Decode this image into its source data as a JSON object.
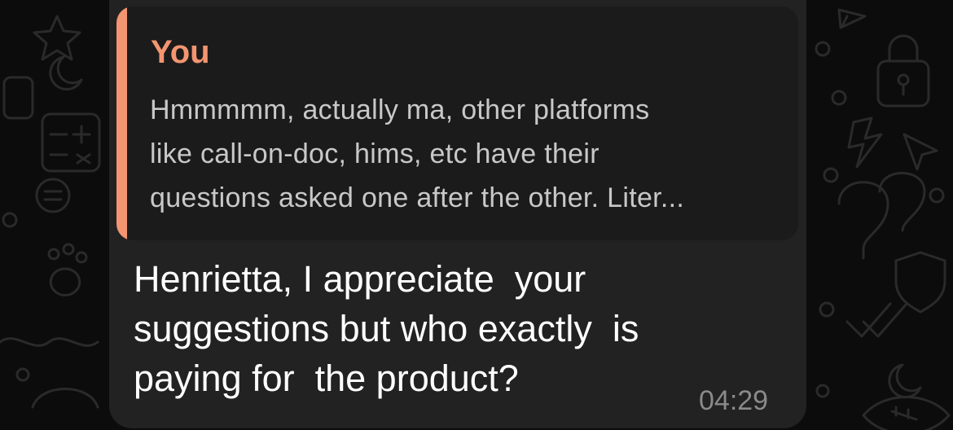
{
  "chat": {
    "message": {
      "quote": {
        "author": "You",
        "lines": [
          "Hmmmmm, actually ma, other platforms",
          "like call-on-doc, hims, etc have their",
          "questions asked one after the other. Liter..."
        ]
      },
      "text_lines": [
        "Henrietta, I appreciate  your",
        "suggestions but who exactly  is",
        "paying for  the product?"
      ],
      "time": "04:29"
    }
  },
  "colors": {
    "background": "#0c0c0c",
    "bubble": "#222222",
    "quote_background": "#1b1b1b",
    "quote_accent": "#f39571",
    "quote_text": "#c8c8c8",
    "message_text": "#ffffff",
    "timestamp": "#8a8a8a"
  },
  "icons": [
    "send-doodle-icon",
    "lock-doodle-icon",
    "lightning-doodle-icon",
    "calculator-doodle-icon",
    "moon-doodle-icon",
    "paw-doodle-icon",
    "check-doodle-icon"
  ]
}
